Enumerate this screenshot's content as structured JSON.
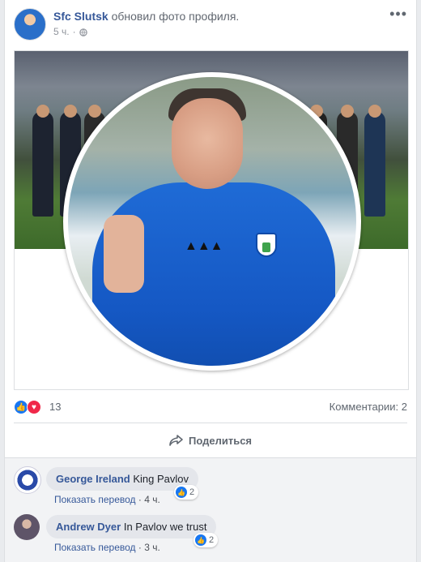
{
  "post": {
    "author": "Sfc Slutsk",
    "action": "обновил фото профиля.",
    "time": "5 ч.",
    "separator": "·",
    "more_icon": "more-dots-icon",
    "privacy_icon": "globe-icon"
  },
  "reactions": {
    "count": "13",
    "comments_label": "Комментарии: 2",
    "types": [
      "like",
      "love"
    ]
  },
  "actions": {
    "share_label": "Поделиться"
  },
  "comments": [
    {
      "author": "George Ireland",
      "text": "King Pavlov",
      "translate": "Показать перевод",
      "time": "· 4 ч.",
      "likes": "2"
    },
    {
      "author": "Andrew Dyer",
      "text": "In Pavlov we trust",
      "translate": "Показать перевод",
      "time": "· 3 ч.",
      "likes": "2"
    }
  ],
  "colors": {
    "link": "#365899",
    "like": "#1877f2",
    "love": "#f02849",
    "jacket": "#1f6bd6"
  }
}
